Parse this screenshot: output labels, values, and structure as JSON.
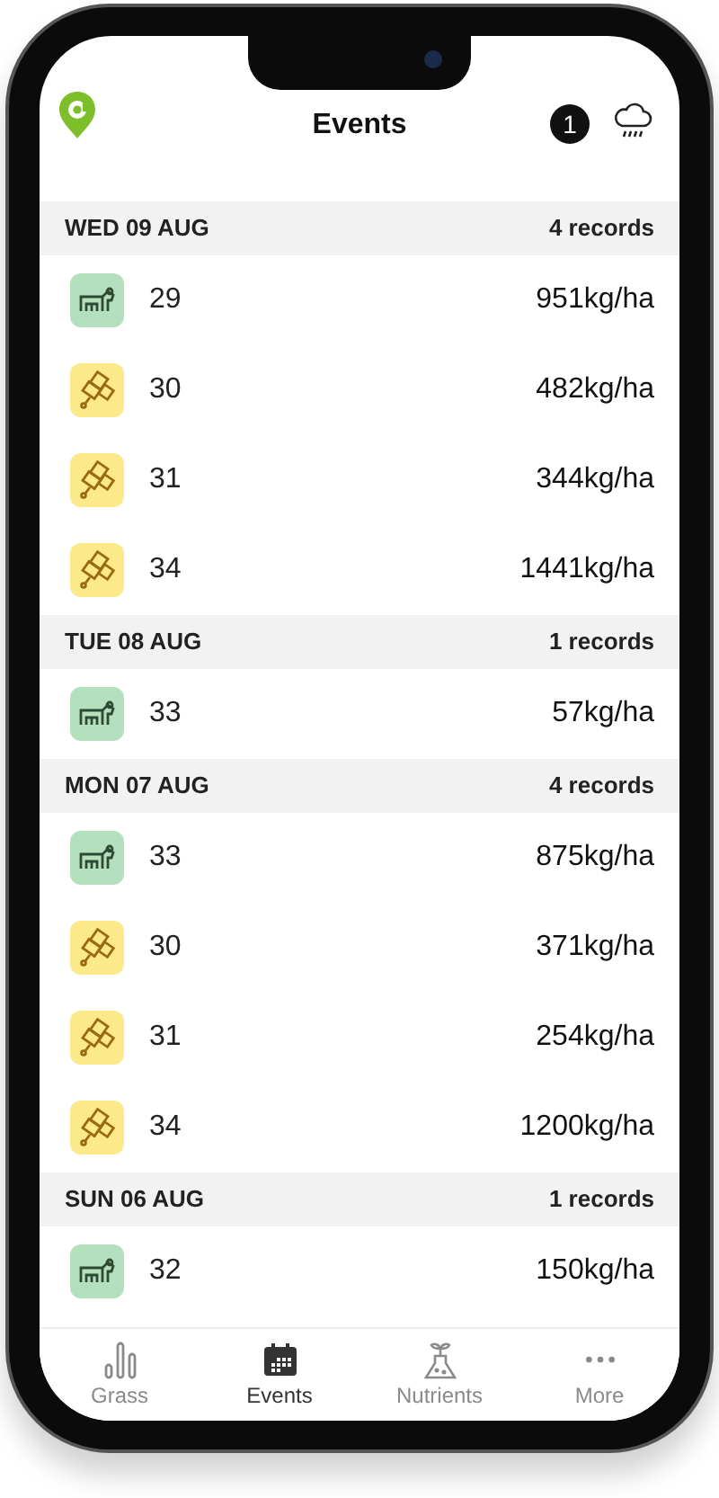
{
  "header": {
    "title": "Events",
    "notification_count": "1"
  },
  "groups": [
    {
      "date": "WED 09 AUG",
      "count": "4 records",
      "records": [
        {
          "kind": "grazing",
          "paddock": "29",
          "amount": "951kg/ha"
        },
        {
          "kind": "fertiliser",
          "paddock": "30",
          "amount": "482kg/ha"
        },
        {
          "kind": "fertiliser",
          "paddock": "31",
          "amount": "344kg/ha"
        },
        {
          "kind": "fertiliser",
          "paddock": "34",
          "amount": "1441kg/ha"
        }
      ]
    },
    {
      "date": "TUE 08 AUG",
      "count": "1 records",
      "records": [
        {
          "kind": "grazing",
          "paddock": "33",
          "amount": "57kg/ha"
        }
      ]
    },
    {
      "date": "MON 07 AUG",
      "count": "4 records",
      "records": [
        {
          "kind": "grazing",
          "paddock": "33",
          "amount": "875kg/ha"
        },
        {
          "kind": "fertiliser",
          "paddock": "30",
          "amount": "371kg/ha"
        },
        {
          "kind": "fertiliser",
          "paddock": "31",
          "amount": "254kg/ha"
        },
        {
          "kind": "fertiliser",
          "paddock": "34",
          "amount": "1200kg/ha"
        }
      ]
    },
    {
      "date": "SUN 06 AUG",
      "count": "1 records",
      "records": [
        {
          "kind": "grazing",
          "paddock": "32",
          "amount": "150kg/ha"
        }
      ]
    }
  ],
  "tabs": [
    {
      "kind": "grass",
      "label": "Grass",
      "selected": false
    },
    {
      "kind": "events",
      "label": "Events",
      "selected": true
    },
    {
      "kind": "nutrients",
      "label": "Nutrients",
      "selected": false
    },
    {
      "kind": "more",
      "label": "More",
      "selected": false
    }
  ]
}
